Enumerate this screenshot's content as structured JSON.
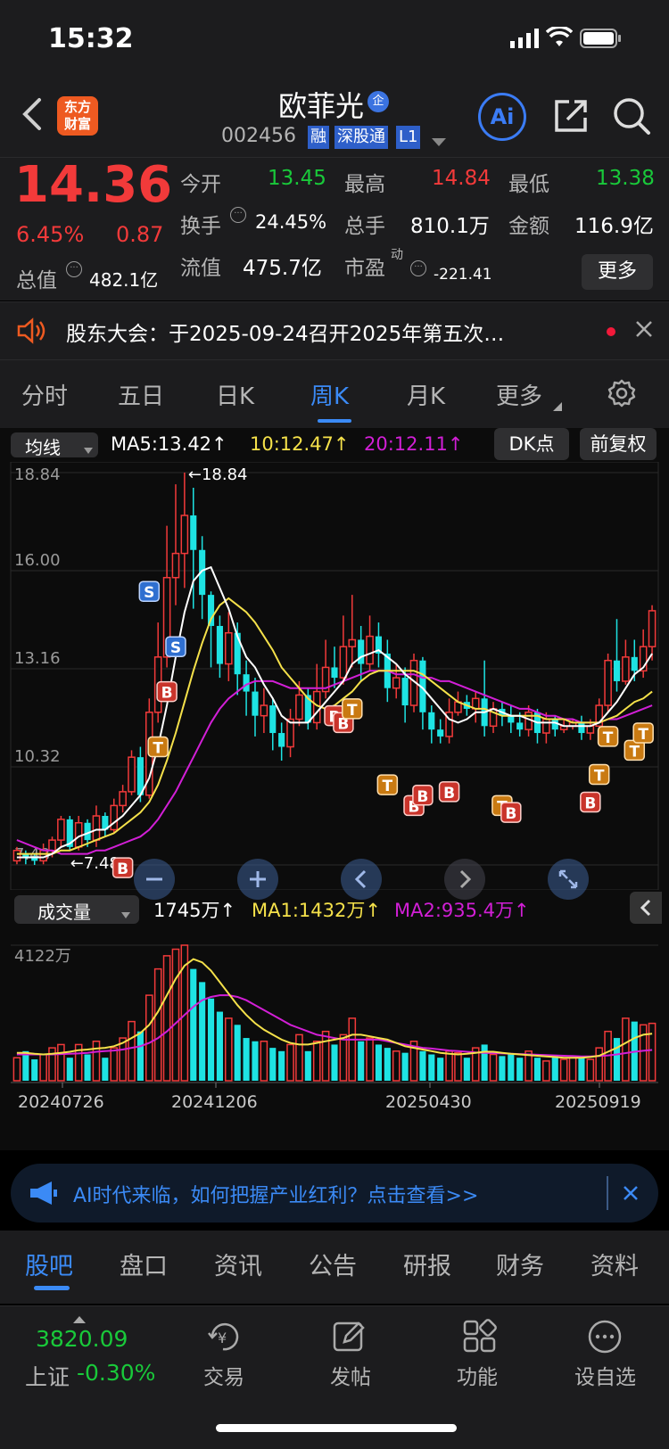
{
  "status_bar": {
    "time": "15:32"
  },
  "header": {
    "stock_name": "欧菲光",
    "stock_code": "002456",
    "tags": [
      "融",
      "深股通",
      "L1"
    ],
    "logo_text_line1": "东方",
    "logo_text_line2": "财富",
    "ai_label": "Ai",
    "name_badge": "企"
  },
  "quote": {
    "price": "14.36",
    "change_pct": "6.45%",
    "change": "0.87",
    "open_label": "今开",
    "open": "13.45",
    "high_label": "最高",
    "high": "14.84",
    "low_label": "最低",
    "low": "13.38",
    "turnover_label": "换手",
    "turnover": "24.45%",
    "volume_label": "总手",
    "volume": "810.1万",
    "amount_label": "金额",
    "amount": "116.9亿",
    "mktcap_label": "总值",
    "mktcap": "482.1亿",
    "float_label": "流值",
    "float_cap": "475.7亿",
    "pe_label": "市盈",
    "pe_sup": "动",
    "pe": "-221.41",
    "more_button": "更多"
  },
  "notice": {
    "text": "股东大会：于2025-09-24召开2025年第五次…"
  },
  "tabs": {
    "items": [
      "分时",
      "五日",
      "日K",
      "周K",
      "月K",
      "更多"
    ],
    "active": 3
  },
  "kline_bar": {
    "indicator": "均线",
    "ma5": "MA5:13.42↑",
    "ma10": "10:12.47↑",
    "ma20": "20:12.11↑",
    "dk_button": "DK点",
    "adjust_button": "前复权"
  },
  "volume_bar": {
    "indicator": "成交量",
    "vol": "1745万↑",
    "ma1": "MA1:1432万↑",
    "ma2": "MA2:935.4万↑"
  },
  "chart_data": {
    "type": "candlestick",
    "price_ticks": [
      "18.84",
      "16.00",
      "13.16",
      "10.32",
      "7.48"
    ],
    "ylim": [
      7.48,
      18.84
    ],
    "max_label": "←18.84",
    "min_label": "←7.48",
    "volume_max_label": "4122万",
    "x_ticks": [
      "20240726",
      "20241206",
      "20250430",
      "20250919"
    ],
    "colors": {
      "up": "#f23a3a",
      "down": "#1ee3e3",
      "ma5": "#ffffff",
      "ma10": "#f5e14a",
      "ma20": "#d21fd6"
    },
    "candles": [
      [
        7.6,
        7.9,
        7.5,
        8.0,
        1
      ],
      [
        7.8,
        7.7,
        7.5,
        7.9,
        0
      ],
      [
        7.7,
        7.6,
        7.48,
        7.8,
        0
      ],
      [
        7.6,
        7.9,
        7.5,
        8.1,
        1
      ],
      [
        7.9,
        8.2,
        7.7,
        8.3,
        1
      ],
      [
        8.2,
        8.8,
        8.0,
        8.9,
        1
      ],
      [
        8.8,
        8.0,
        7.9,
        8.9,
        0
      ],
      [
        8.0,
        8.7,
        7.9,
        8.9,
        1
      ],
      [
        8.7,
        8.2,
        8.0,
        8.8,
        0
      ],
      [
        8.2,
        8.9,
        8.0,
        9.2,
        1
      ],
      [
        8.9,
        8.5,
        8.3,
        9.0,
        0
      ],
      [
        8.5,
        9.2,
        8.4,
        9.4,
        1
      ],
      [
        9.2,
        9.6,
        9.0,
        9.8,
        1
      ],
      [
        9.6,
        10.6,
        9.5,
        10.8,
        1
      ],
      [
        10.6,
        9.5,
        9.3,
        10.9,
        0
      ],
      [
        9.5,
        11.9,
        9.4,
        12.3,
        1
      ],
      [
        11.9,
        13.5,
        11.6,
        14.5,
        1
      ],
      [
        13.5,
        15.8,
        13.2,
        17.3,
        1
      ],
      [
        15.8,
        16.5,
        15.0,
        18.5,
        1
      ],
      [
        16.5,
        17.6,
        15.5,
        18.84,
        1
      ],
      [
        17.6,
        16.6,
        14.9,
        18.4,
        0
      ],
      [
        16.6,
        15.3,
        14.6,
        17.0,
        0
      ],
      [
        15.3,
        14.4,
        13.2,
        15.4,
        0
      ],
      [
        14.4,
        13.3,
        12.9,
        14.7,
        0
      ],
      [
        13.3,
        14.2,
        12.8,
        14.8,
        1
      ],
      [
        14.2,
        13.0,
        12.4,
        14.5,
        0
      ],
      [
        13.0,
        12.5,
        11.8,
        13.4,
        0
      ],
      [
        12.5,
        11.8,
        11.2,
        12.9,
        0
      ],
      [
        11.8,
        12.1,
        11.3,
        12.6,
        1
      ],
      [
        12.1,
        11.3,
        10.8,
        12.3,
        0
      ],
      [
        11.3,
        10.9,
        10.5,
        11.6,
        0
      ],
      [
        10.9,
        11.7,
        10.6,
        12.0,
        1
      ],
      [
        11.7,
        12.4,
        11.5,
        12.8,
        1
      ],
      [
        12.4,
        11.6,
        11.4,
        12.6,
        0
      ],
      [
        11.6,
        12.5,
        11.4,
        13.3,
        1
      ],
      [
        12.5,
        13.2,
        12.3,
        14.0,
        1
      ],
      [
        13.2,
        12.9,
        12.6,
        13.8,
        0
      ],
      [
        12.9,
        13.8,
        12.7,
        14.7,
        1
      ],
      [
        13.8,
        14.0,
        13.2,
        15.3,
        1
      ],
      [
        14.0,
        13.3,
        12.8,
        14.4,
        0
      ],
      [
        13.3,
        14.1,
        13.1,
        14.7,
        1
      ],
      [
        14.1,
        13.6,
        13.2,
        14.5,
        0
      ],
      [
        13.6,
        12.6,
        12.2,
        14.0,
        0
      ],
      [
        12.6,
        12.9,
        12.3,
        13.3,
        1
      ],
      [
        12.9,
        12.1,
        11.6,
        13.2,
        0
      ],
      [
        12.1,
        13.4,
        11.9,
        13.6,
        1
      ],
      [
        13.4,
        11.9,
        11.4,
        13.5,
        0
      ],
      [
        11.9,
        11.4,
        11.0,
        12.1,
        0
      ],
      [
        11.4,
        11.2,
        11.0,
        11.7,
        0
      ],
      [
        11.2,
        11.9,
        11.0,
        12.3,
        1
      ],
      [
        11.9,
        12.2,
        11.8,
        12.5,
        1
      ],
      [
        12.2,
        12.0,
        11.8,
        12.4,
        0
      ],
      [
        12.0,
        12.3,
        11.6,
        12.5,
        1
      ],
      [
        12.3,
        11.5,
        11.2,
        13.4,
        0
      ],
      [
        11.5,
        12.0,
        11.3,
        12.2,
        1
      ],
      [
        12.0,
        11.8,
        11.5,
        12.2,
        0
      ],
      [
        11.8,
        11.6,
        11.3,
        12.1,
        0
      ],
      [
        11.6,
        11.4,
        11.2,
        11.9,
        0
      ],
      [
        11.4,
        11.9,
        11.2,
        12.1,
        1
      ],
      [
        11.9,
        11.3,
        11.0,
        12.0,
        0
      ],
      [
        11.3,
        11.7,
        11.0,
        11.9,
        1
      ],
      [
        11.7,
        11.4,
        11.2,
        11.8,
        0
      ],
      [
        11.4,
        11.5,
        11.3,
        11.7,
        1
      ],
      [
        11.5,
        11.6,
        11.4,
        11.7,
        1
      ],
      [
        11.6,
        11.3,
        11.1,
        11.8,
        0
      ],
      [
        11.3,
        11.5,
        11.1,
        11.7,
        1
      ],
      [
        11.5,
        12.1,
        11.3,
        12.3,
        1
      ],
      [
        12.1,
        13.4,
        11.9,
        13.6,
        1
      ],
      [
        13.4,
        12.8,
        12.5,
        14.6,
        0
      ],
      [
        12.8,
        13.5,
        12.7,
        14.0,
        1
      ],
      [
        13.5,
        13.1,
        12.8,
        14.0,
        0
      ],
      [
        13.1,
        13.8,
        12.9,
        14.3,
        1
      ],
      [
        13.8,
        14.84,
        13.4,
        15.0,
        1
      ]
    ],
    "ma5_values": [
      7.7,
      7.7,
      7.7,
      7.7,
      7.8,
      8.0,
      8.1,
      8.3,
      8.4,
      8.5,
      8.5,
      8.7,
      8.9,
      9.2,
      9.5,
      10.0,
      10.9,
      12.1,
      13.5,
      14.8,
      15.7,
      16.0,
      16.1,
      15.5,
      14.9,
      14.1,
      13.5,
      13.2,
      12.7,
      12.3,
      11.8,
      11.6,
      11.6,
      11.6,
      11.9,
      12.2,
      12.5,
      12.8,
      13.3,
      13.5,
      13.6,
      13.7,
      13.5,
      13.3,
      13.0,
      12.8,
      12.6,
      12.3,
      12.0,
      11.7,
      11.6,
      11.7,
      11.9,
      11.9,
      12.0,
      11.9,
      11.8,
      11.8,
      11.7,
      11.6,
      11.6,
      11.6,
      11.5,
      11.5,
      11.5,
      11.5,
      11.6,
      11.9,
      12.2,
      12.6,
      13.0,
      13.2,
      13.6
    ],
    "ma10_values": [
      7.8,
      7.8,
      7.8,
      7.8,
      7.8,
      7.9,
      7.9,
      8.0,
      8.1,
      8.2,
      8.3,
      8.4,
      8.6,
      8.8,
      9.0,
      9.3,
      9.8,
      10.5,
      11.3,
      12.2,
      13.1,
      13.9,
      14.6,
      15.0,
      15.2,
      15.0,
      14.8,
      14.5,
      14.1,
      13.7,
      13.2,
      12.9,
      12.6,
      12.3,
      12.1,
      12.0,
      12.1,
      12.3,
      12.5,
      12.8,
      13.0,
      13.1,
      13.1,
      13.1,
      13.1,
      13.1,
      13.0,
      12.8,
      12.6,
      12.4,
      12.2,
      12.1,
      12.0,
      12.0,
      11.9,
      11.8,
      11.8,
      11.8,
      11.8,
      11.8,
      11.7,
      11.7,
      11.7,
      11.6,
      11.6,
      11.6,
      11.6,
      11.7,
      11.8,
      12.0,
      12.2,
      12.3,
      12.5
    ],
    "ma20_values": [
      8.2,
      8.1,
      8.0,
      7.9,
      7.9,
      7.8,
      7.8,
      7.8,
      7.8,
      7.9,
      7.9,
      8.0,
      8.1,
      8.2,
      8.3,
      8.5,
      8.8,
      9.2,
      9.6,
      10.1,
      10.6,
      11.1,
      11.6,
      12.0,
      12.3,
      12.5,
      12.7,
      12.8,
      12.8,
      12.8,
      12.7,
      12.6,
      12.6,
      12.6,
      12.6,
      12.6,
      12.7,
      12.8,
      12.9,
      13.0,
      13.1,
      13.1,
      13.1,
      13.0,
      13.0,
      13.0,
      12.9,
      12.9,
      12.8,
      12.8,
      12.7,
      12.6,
      12.5,
      12.4,
      12.3,
      12.2,
      12.1,
      12.0,
      12.0,
      11.9,
      11.8,
      11.8,
      11.7,
      11.7,
      11.6,
      11.6,
      11.6,
      11.7,
      11.7,
      11.8,
      11.9,
      12.0,
      12.1
    ],
    "volumes": [
      700,
      900,
      650,
      800,
      1000,
      1100,
      700,
      1100,
      800,
      1200,
      700,
      1000,
      1300,
      1800,
      1500,
      2600,
      3400,
      3800,
      4000,
      4122,
      3400,
      3000,
      2500,
      2100,
      1900,
      1700,
      1300,
      1200,
      1200,
      1000,
      900,
      1100,
      1400,
      900,
      1200,
      1500,
      1100,
      1400,
      1900,
      1200,
      1300,
      1100,
      1000,
      900,
      850,
      1200,
      900,
      800,
      700,
      900,
      850,
      700,
      1000,
      1100,
      800,
      750,
      800,
      700,
      900,
      700,
      600,
      750,
      650,
      700,
      700,
      650,
      1000,
      1500,
      1300,
      1900,
      1800,
      1700,
      1745
    ],
    "vol_ma1": [
      850,
      850,
      820,
      800,
      820,
      850,
      880,
      930,
      950,
      980,
      1000,
      1050,
      1150,
      1300,
      1450,
      1700,
      2100,
      2600,
      3100,
      3500,
      3700,
      3600,
      3350,
      3000,
      2650,
      2300,
      2000,
      1750,
      1550,
      1400,
      1250,
      1150,
      1100,
      1100,
      1150,
      1200,
      1250,
      1300,
      1400,
      1400,
      1350,
      1300,
      1250,
      1150,
      1050,
      1000,
      950,
      900,
      850,
      820,
      800,
      820,
      850,
      880,
      880,
      850,
      820,
      800,
      780,
      760,
      740,
      720,
      700,
      700,
      700,
      720,
      760,
      880,
      1000,
      1150,
      1300,
      1400,
      1432
    ],
    "vol_ma2": [
      800,
      800,
      800,
      800,
      800,
      810,
      820,
      830,
      850,
      880,
      900,
      920,
      950,
      1000,
      1050,
      1150,
      1300,
      1500,
      1750,
      2000,
      2250,
      2450,
      2550,
      2600,
      2600,
      2550,
      2450,
      2300,
      2150,
      2000,
      1850,
      1700,
      1600,
      1500,
      1400,
      1350,
      1300,
      1250,
      1250,
      1250,
      1250,
      1250,
      1200,
      1150,
      1100,
      1050,
      1000,
      980,
      950,
      920,
      900,
      880,
      860,
      850,
      840,
      830,
      820,
      810,
      800,
      790,
      780,
      770,
      760,
      750,
      740,
      740,
      750,
      770,
      800,
      840,
      880,
      910,
      935.4
    ],
    "signals": [
      {
        "i": 15,
        "label": "S",
        "price": 15.4
      },
      {
        "i": 18,
        "label": "S",
        "price": 13.8
      },
      {
        "i": 17,
        "label": "B",
        "price": 12.5
      },
      {
        "i": 16,
        "label": "T",
        "price": 10.9
      },
      {
        "i": 12,
        "label": "B",
        "price": 7.4
      },
      {
        "i": 36,
        "label": "B",
        "price": 11.8
      },
      {
        "i": 37,
        "label": "B",
        "price": 11.6
      },
      {
        "i": 38,
        "label": "T",
        "price": 12.0
      },
      {
        "i": 42,
        "label": "T",
        "price": 9.8
      },
      {
        "i": 45,
        "label": "B",
        "price": 9.2
      },
      {
        "i": 46,
        "label": "B",
        "price": 9.5
      },
      {
        "i": 49,
        "label": "B",
        "price": 9.6
      },
      {
        "i": 55,
        "label": "T",
        "price": 9.2
      },
      {
        "i": 56,
        "label": "B",
        "price": 9.0
      },
      {
        "i": 65,
        "label": "B",
        "price": 9.3
      },
      {
        "i": 66,
        "label": "T",
        "price": 10.1
      },
      {
        "i": 67,
        "label": "T",
        "price": 11.2
      },
      {
        "i": 70,
        "label": "T",
        "price": 10.8
      },
      {
        "i": 71,
        "label": "T",
        "price": 11.3
      }
    ]
  },
  "ad": {
    "text": "AI时代来临，如何把握产业红利？点击查看>>"
  },
  "sub_tabs": {
    "items": [
      "股吧",
      "盘口",
      "资讯",
      "公告",
      "研报",
      "财务",
      "资料"
    ],
    "active": 0
  },
  "bottom_bar": {
    "index_value": "3820.09",
    "index_name": "上证",
    "index_change": "-0.30%",
    "items": [
      "交易",
      "发帖",
      "功能",
      "设自选"
    ]
  }
}
